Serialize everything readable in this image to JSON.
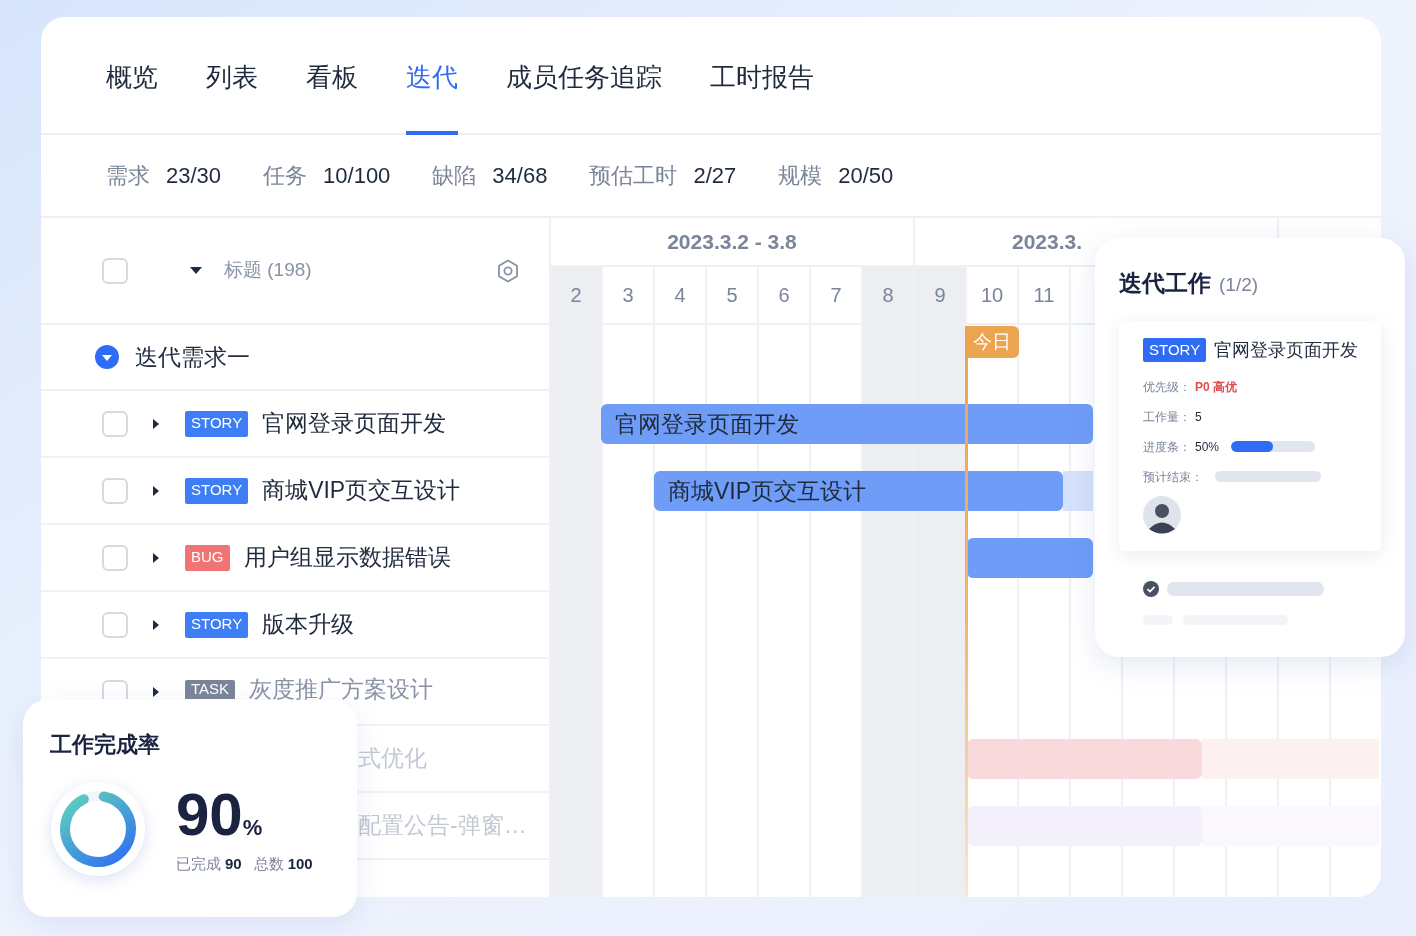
{
  "tabs": [
    {
      "label": "概览",
      "selected": false
    },
    {
      "label": "列表",
      "selected": false
    },
    {
      "label": "看板",
      "selected": false
    },
    {
      "label": "迭代",
      "selected": true
    },
    {
      "label": "成员任务追踪",
      "selected": false
    },
    {
      "label": "工时报告",
      "selected": false
    }
  ],
  "stats": [
    {
      "label": "需求",
      "value": "23/30"
    },
    {
      "label": "任务",
      "value": "10/100"
    },
    {
      "label": "缺陷",
      "value": "34/68"
    },
    {
      "label": "预估工时",
      "value": "2/27"
    },
    {
      "label": "规模",
      "value": "20/50"
    }
  ],
  "list_header": {
    "checked": false,
    "title": "标题 (198)"
  },
  "group": {
    "title": "迭代需求一",
    "expanded": true
  },
  "rows": [
    {
      "kind": "item",
      "checked": false,
      "tag": {
        "text": "STORY",
        "color": "#3d7ef5"
      },
      "title": "官网登录页面开发",
      "bar": {
        "label": "官网登录页面开发",
        "color": "#6e9cf7"
      }
    },
    {
      "kind": "item",
      "checked": false,
      "tag": {
        "text": "STORY",
        "color": "#3d7ef5"
      },
      "title": "商城VIP页交互设计",
      "bar": {
        "label": "商城VIP页交互设计",
        "color": "#6e9cf7"
      },
      "tail": {
        "color": "#d6e2fc"
      }
    },
    {
      "kind": "item",
      "checked": false,
      "tag": {
        "text": "BUG",
        "color": "#f07474"
      },
      "title": "用户组显示数据错误",
      "bar": {
        "color": "#6e9cf7"
      }
    },
    {
      "kind": "item",
      "checked": false,
      "tag": {
        "text": "STORY",
        "color": "#3d7ef5"
      },
      "title": "版本升级"
    },
    {
      "kind": "cut",
      "checked": false,
      "tag": {
        "text": "TASK",
        "color": "#7b8599"
      },
      "title": "灰度推广方案设计"
    },
    {
      "kind": "faded",
      "title": "式优化",
      "bar": {
        "color": "#f8d9dc"
      },
      "tail": {
        "color": "#fcf0f1"
      }
    },
    {
      "kind": "faded",
      "title": "配置公告-弹窗…",
      "bar": {
        "color": "#f3effb"
      },
      "tail": {
        "color": "#faf8fd"
      }
    }
  ],
  "timeline": {
    "weeks": [
      "2023.3.2 - 3.8",
      "2023.3."
    ],
    "days": [
      {
        "label": "2",
        "weekend": true
      },
      {
        "label": "3",
        "weekend": false
      },
      {
        "label": "4",
        "weekend": false
      },
      {
        "label": "5",
        "weekend": false
      },
      {
        "label": "6",
        "weekend": false
      },
      {
        "label": "7",
        "weekend": false
      },
      {
        "label": "8",
        "weekend": true
      },
      {
        "label": "9",
        "weekend": true
      },
      {
        "label": "10",
        "weekend": false
      },
      {
        "label": "11",
        "weekend": false
      }
    ],
    "today": "今日"
  },
  "panel": {
    "title": "迭代工作",
    "count": "(1/2)",
    "card": {
      "tag": "STORY",
      "title": "官网登录页面开发",
      "priority_label": "优先级：",
      "priority": "P0 高优",
      "workload_label": "工作量：",
      "workload": "5",
      "progress_label": "进度条：",
      "progress": "50%",
      "level": 0.5,
      "due_label": "预计结束："
    }
  },
  "completion": {
    "title": "工作完成率",
    "value": "90",
    "unit": "%",
    "level": 0.9,
    "stats": [
      {
        "label": "已完成",
        "value": "90"
      },
      {
        "label": "总数",
        "value": "100"
      }
    ]
  }
}
